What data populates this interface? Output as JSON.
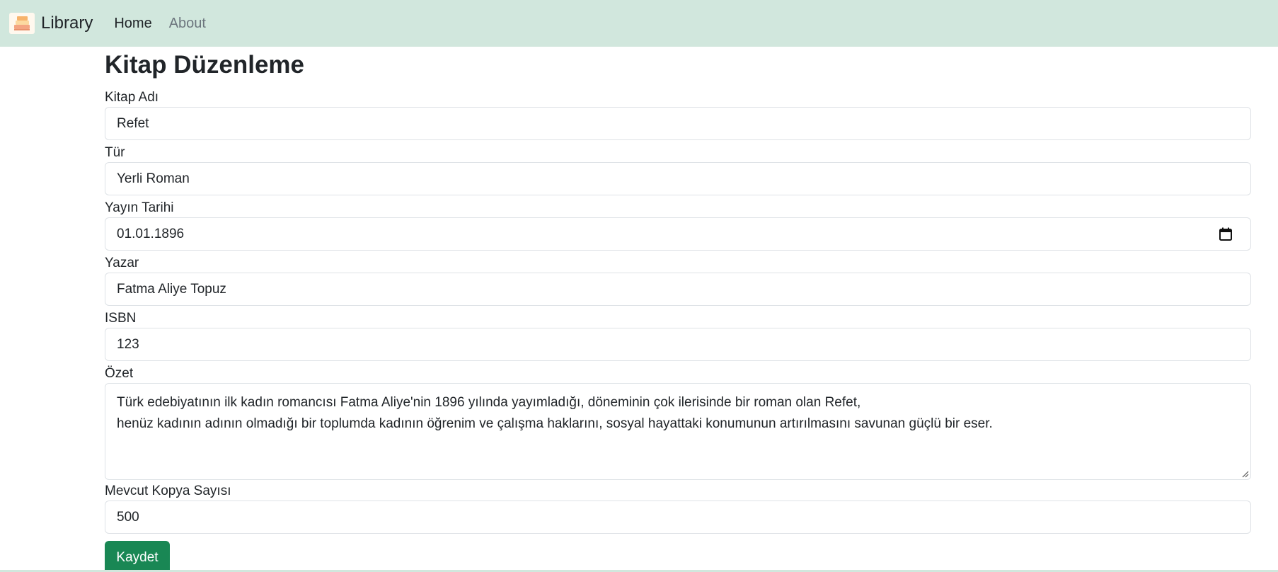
{
  "navbar": {
    "brand_icon": "book-stack-logo",
    "brand_text": "Library",
    "links": [
      {
        "label": "Home",
        "active": true
      },
      {
        "label": "About",
        "active": false
      }
    ],
    "background_color": "#d1e7dd"
  },
  "form": {
    "title": "Kitap Düzenleme",
    "fields": {
      "book_name": {
        "label": "Kitap Adı",
        "value": "Refet"
      },
      "genre": {
        "label": "Tür",
        "value": "Yerli Roman"
      },
      "publish_date": {
        "label": "Yayın Tarihi",
        "value": "01.01.1896",
        "icon": "calendar-icon"
      },
      "author": {
        "label": "Yazar",
        "value": "Fatma Aliye Topuz"
      },
      "isbn": {
        "label": "ISBN",
        "value": "123"
      },
      "summary": {
        "label": "Özet",
        "lines": [
          "Türk edebiyatının ilk kadın romancısı Fatma Aliye'nin 1896 yılında yayımladığı, döneminin çok ilerisinde bir roman olan Refet,",
          "henüz kadının adının olmadığı bir toplumda kadının öğrenim ve çalışma haklarını, sosyal hayattaki konumunun artırılmasını savunan güçlü bir eser."
        ]
      },
      "copies": {
        "label": "Mevcut Kopya Sayısı",
        "value": "500"
      }
    },
    "save_button": {
      "label": "Kaydet",
      "color": "#198754"
    }
  }
}
